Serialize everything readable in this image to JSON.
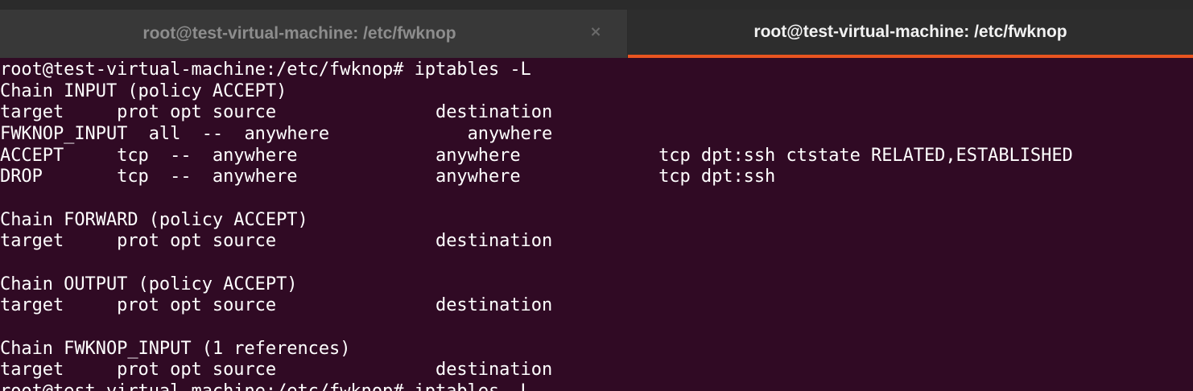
{
  "tabs": [
    {
      "title": "root@test-virtual-machine: /etc/fwknop",
      "active": false,
      "close_glyph": "×"
    },
    {
      "title": "root@test-virtual-machine: /etc/fwknop",
      "active": true
    }
  ],
  "colors": {
    "terminal_background": "#300a24",
    "terminal_text": "#ffffff",
    "active_tab_accent": "#e95420",
    "tab_bar": "#353535"
  },
  "terminal": {
    "lines": [
      "root@test-virtual-machine:/etc/fwknop# iptables -L",
      "Chain INPUT (policy ACCEPT)",
      "target     prot opt source               destination",
      "FWKNOP_INPUT  all  --  anywhere             anywhere",
      "ACCEPT     tcp  --  anywhere             anywhere             tcp dpt:ssh ctstate RELATED,ESTABLISHED",
      "DROP       tcp  --  anywhere             anywhere             tcp dpt:ssh",
      "",
      "Chain FORWARD (policy ACCEPT)",
      "target     prot opt source               destination",
      "",
      "Chain OUTPUT (policy ACCEPT)",
      "target     prot opt source               destination",
      "",
      "Chain FWKNOP_INPUT (1 references)",
      "target     prot opt source               destination",
      "root@test-virtual-machine:/etc/fwknop# iptables -L"
    ]
  }
}
